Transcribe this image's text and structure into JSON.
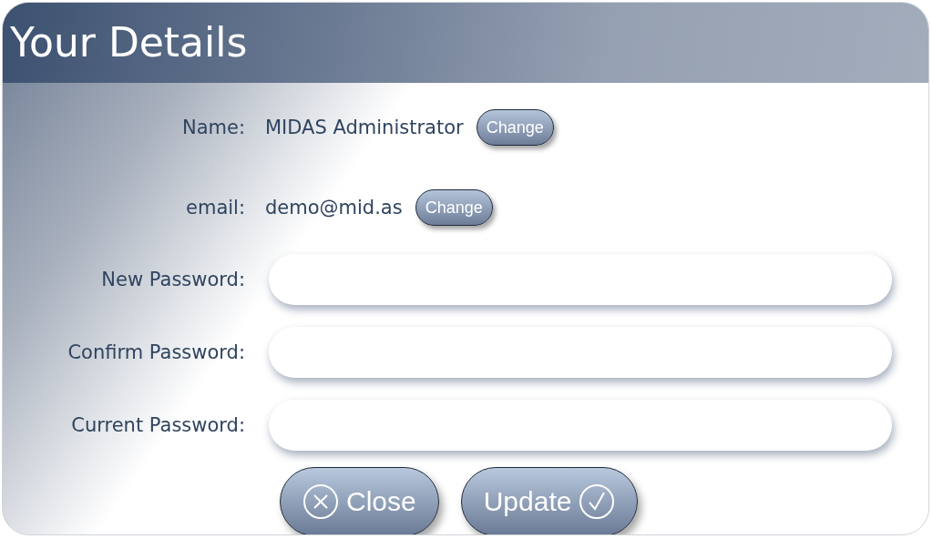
{
  "window": {
    "title": "Your Details"
  },
  "details": [
    {
      "label": "Name:",
      "value": "MIDAS Administrator",
      "button": "Change"
    },
    {
      "label": "email:",
      "value": "demo@mid.as",
      "button": "Change"
    }
  ],
  "password_fields": [
    {
      "label": "New Password:"
    },
    {
      "label": "Confirm Password:"
    },
    {
      "label": "Current Password:"
    }
  ],
  "buttons": [
    {
      "label": "Close",
      "kind": "close"
    },
    {
      "label": "Update",
      "kind": "update"
    }
  ]
}
